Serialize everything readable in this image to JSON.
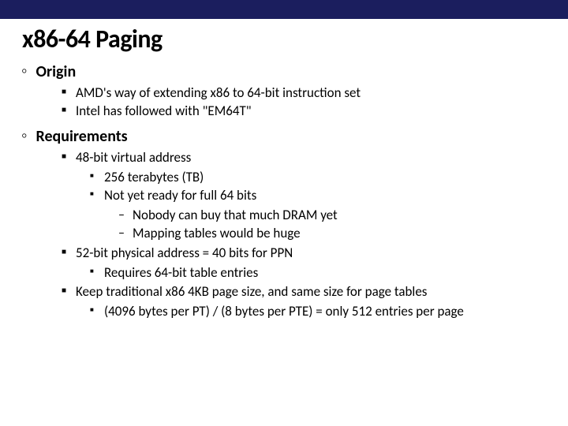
{
  "title": "x86-64 Paging",
  "sections": [
    {
      "label": "Origin",
      "items": [
        {
          "text": "AMD's way of extending x86 to 64-bit instruction set"
        },
        {
          "text": "Intel has followed with \"EM64T\""
        }
      ]
    },
    {
      "label": "Requirements",
      "items": [
        {
          "text": "48-bit virtual address",
          "sub": [
            {
              "text": "256 terabytes (TB)"
            },
            {
              "text": "Not yet ready for full 64 bits",
              "sub": [
                {
                  "text": "Nobody can buy that much DRAM yet"
                },
                {
                  "text": "Mapping tables would be huge"
                }
              ]
            }
          ]
        },
        {
          "text": "52-bit physical address = 40 bits for PPN",
          "sub": [
            {
              "text": "Requires 64-bit table entries"
            }
          ]
        },
        {
          "text": "Keep traditional x86 4KB page size, and same size for page tables",
          "sub": [
            {
              "text": "(4096 bytes per PT) / (8 bytes per PTE) = only 512 entries per page"
            }
          ]
        }
      ]
    }
  ]
}
